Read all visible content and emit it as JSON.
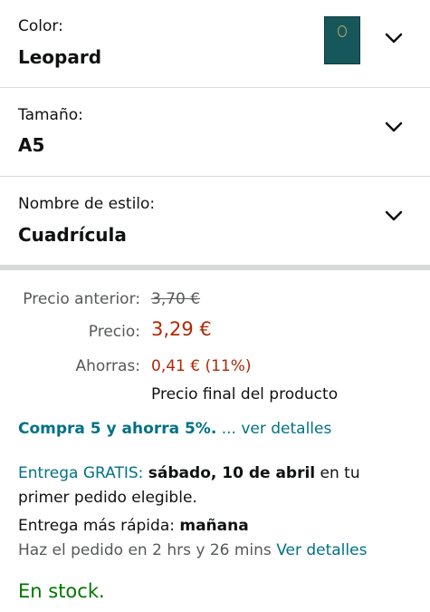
{
  "variations": [
    {
      "label": "Color:",
      "value": "Leopard"
    },
    {
      "label": "Tamaño:",
      "value": "A5"
    },
    {
      "label": "Nombre de estilo:",
      "value": "Cuadrícula"
    }
  ],
  "pricing": {
    "previous_label": "Precio anterior:",
    "previous_value": "3,70 €",
    "price_label": "Precio:",
    "price_value": "3,29 €",
    "savings_label": "Ahorras:",
    "savings_value": "0,41 € (11%)",
    "final_note": "Precio final del producto"
  },
  "promo": {
    "offer": "Compra 5 y ahorra 5%.",
    "details_link": "... ver detalles"
  },
  "delivery": {
    "free_label": "Entrega GRATIS:",
    "free_date": "sábado, 10 de abril",
    "free_suffix": "en tu",
    "free_line2": "primer pedido elegible.",
    "fast_label": "Entrega más rápida:",
    "fast_date": "mañana",
    "order_within": "Haz el pedido en 2 hrs y 26 mins",
    "details_link": "Ver detalles"
  },
  "stock": "En stock.",
  "colors": {
    "price_red": "#b12704",
    "link_teal": "#007185",
    "stock_green": "#007600",
    "swatch": "#16575b"
  }
}
